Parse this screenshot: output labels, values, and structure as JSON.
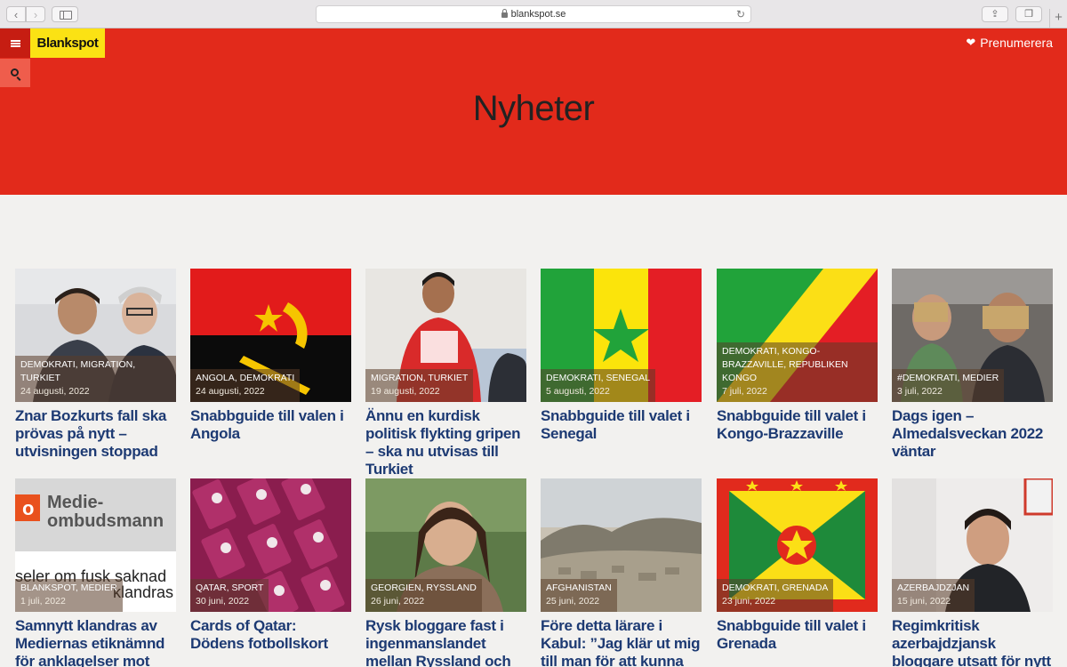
{
  "browser": {
    "url": "blankspot.se",
    "back_glyph": "‹",
    "forward_glyph": "›",
    "reload_glyph": "↻",
    "share_glyph": "⇪",
    "tabs_glyph": "❐",
    "newtab_glyph": "+"
  },
  "site": {
    "logo_text": "Blankspot",
    "subscribe_label": "Prenumerera",
    "page_title": "Nyheter",
    "accent": "#e22a1b",
    "logo_bg": "#fbe214",
    "headline_color": "#1d3a73"
  },
  "articles": [
    {
      "tags": "DEMOKRATI, MIGRATION, TURKIET",
      "date": "24 augusti, 2022",
      "title": "Znar Bozkurts fall ska prövas på nytt – utvisningen stoppad"
    },
    {
      "tags": "ANGOLA, DEMOKRATI",
      "date": "24 augusti, 2022",
      "title": "Snabbguide till valen i Angola"
    },
    {
      "tags": "MIGRATION, TURKIET",
      "date": "19 augusti, 2022",
      "title": "Ännu en kurdisk politisk flykting gripen – ska nu utvisas till Turkiet"
    },
    {
      "tags": "DEMOKRATI, SENEGAL",
      "date": "5 augusti, 2022",
      "title": "Snabbguide till valet i Senegal"
    },
    {
      "tags": "DEMOKRATI, KONGO-BRAZZAVILLE, REPUBLIKEN KONGO",
      "date": "7 juli, 2022",
      "title": "Snabbguide till valet i Kongo-Brazzaville"
    },
    {
      "tags": "#DEMOKRATI, MEDIER",
      "date": "3 juli, 2022",
      "title": "Dags igen – Almedalsveckan 2022 väntar"
    },
    {
      "tags": "BLANKSPOT, MEDIER",
      "date": "1 juli, 2022",
      "title": "Samnytt klandras av Mediernas etiknämnd för anklagelser mot",
      "image_text_1": "Medie-",
      "image_text_2": "ombudsmann",
      "image_text_3": "seler om fusk saknad",
      "image_text_4": "klandras"
    },
    {
      "tags": "QATAR, SPORT",
      "date": "30 juni, 2022",
      "title": "Cards of Qatar: Dödens fotbollskort"
    },
    {
      "tags": "GEORGIEN, RYSSLAND",
      "date": "26 juni, 2022",
      "title": "Rysk bloggare fast i ingenmanslandet mellan Ryssland och Georgien"
    },
    {
      "tags": "AFGHANISTAN",
      "date": "25 juni, 2022",
      "title": "Före detta lärare i Kabul: ”Jag klär ut mig till man för att kunna gå ut”"
    },
    {
      "tags": "DEMOKRATI, GRENADA",
      "date": "23 juni, 2022",
      "title": "Snabbguide till valet i Grenada"
    },
    {
      "tags": "AZERBAJDZJAN",
      "date": "15 juni, 2022",
      "title": "Regimkritisk azerbajdzjansk bloggare utsatt för nytt"
    }
  ]
}
